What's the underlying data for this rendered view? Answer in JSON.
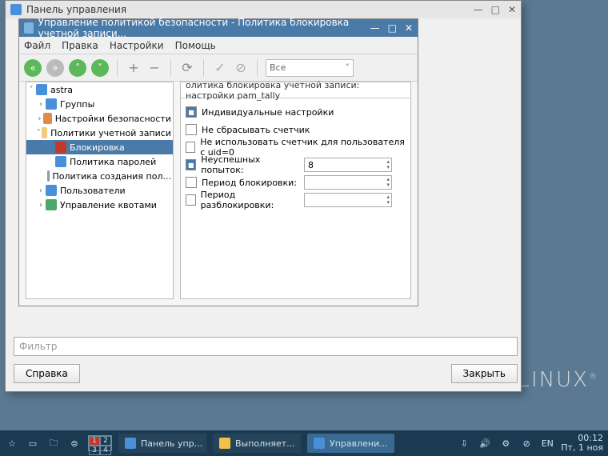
{
  "outer_window": {
    "title": "Панель управления",
    "filter_placeholder": "Фильтр",
    "help_btn": "Справка",
    "close_btn": "Закрыть"
  },
  "inner_window": {
    "title": "Управление политикой безопасности - Политика блокировка учетной записи...",
    "menu": {
      "file": "Файл",
      "edit": "Правка",
      "settings": "Настройки",
      "help": "Помощь"
    },
    "filter_dropdown": "Все"
  },
  "tree": {
    "root": "astra",
    "groups": "Группы",
    "security": "Настройки безопасности",
    "acct_policies": "Политики учетной записи",
    "lockout": "Блокировка",
    "passwords": "Политика паролей",
    "creation": "Политика создания пол...",
    "users": "Пользователи",
    "quotas": "Управление квотами"
  },
  "content": {
    "header": "олитика блокировка учетной записи: настройки pam_tally",
    "individual": "Индивидуальные настройки",
    "no_reset": "Не сбрасывать счетчик",
    "no_uid0": "Не использовать счетчик для пользователя с uid=0",
    "fail_attempts": "Неуспешных попыток:",
    "fail_attempts_value": "8",
    "lock_period": "Период блокировки:",
    "unlock_period": "Период разблокировки:"
  },
  "taskbar": {
    "task1": "Панель упр...",
    "task2": "Выполняет...",
    "task3": "Управлени...",
    "lang": "EN",
    "time": "00:12",
    "date": "Пт, 1 ноя"
  },
  "desktop_logo": "LINUX"
}
